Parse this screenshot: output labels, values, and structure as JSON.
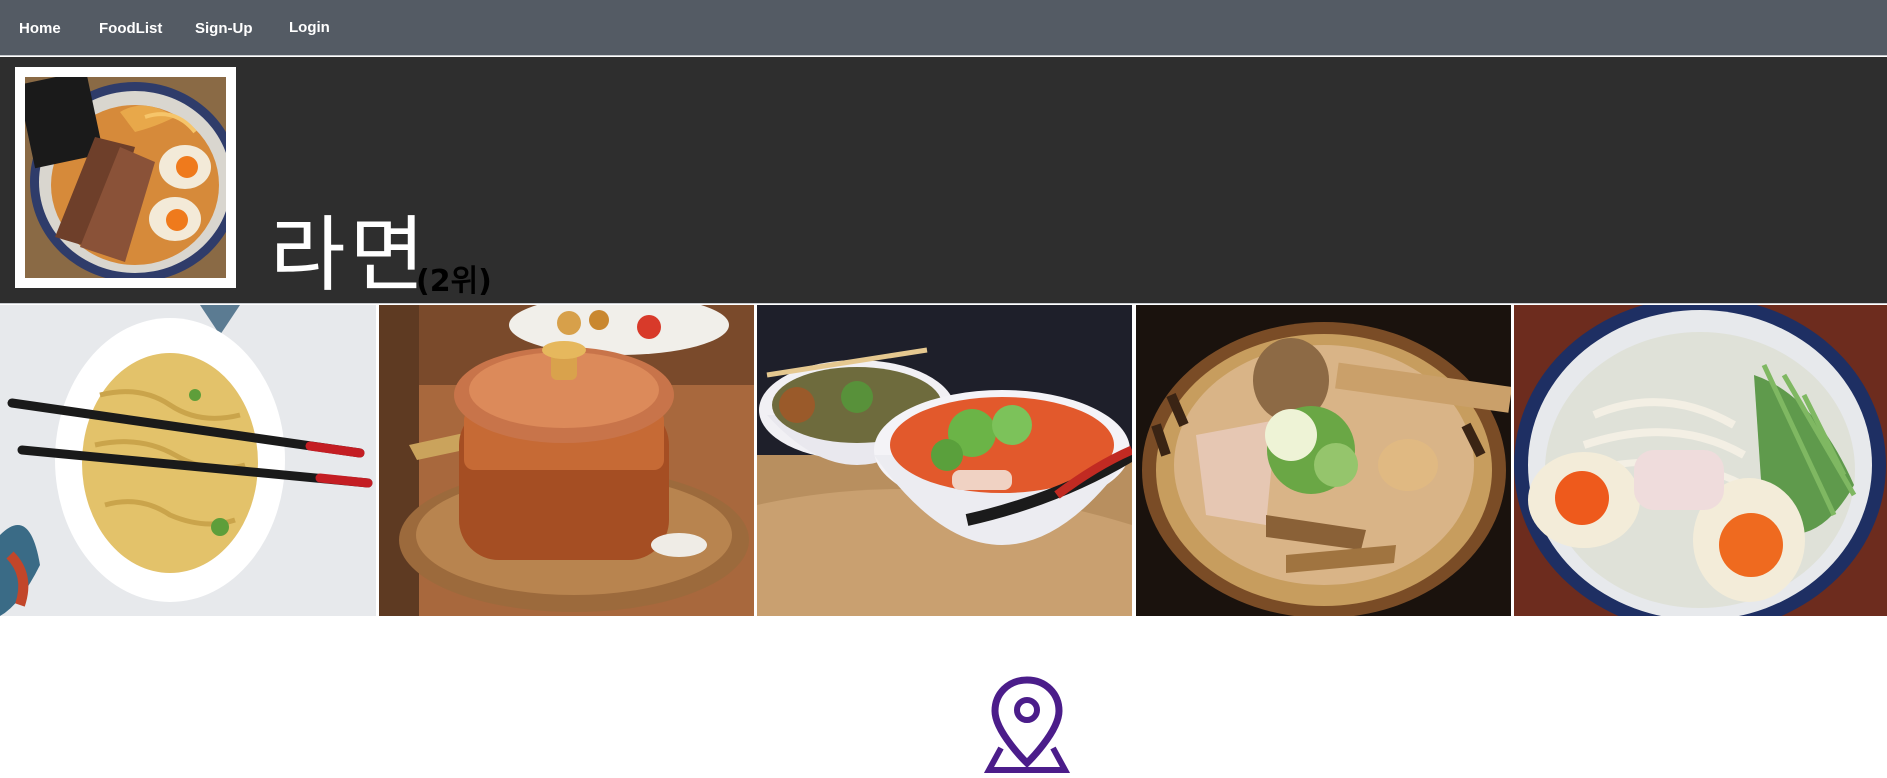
{
  "nav": {
    "items": [
      {
        "label": "Home"
      },
      {
        "label": "FoodList"
      },
      {
        "label": "Sign-Up"
      },
      {
        "label": "Login"
      }
    ]
  },
  "header": {
    "title": "라면",
    "rank": "(2위)",
    "thumbnail_icon": "ramen-bowl-photo"
  },
  "gallery": {
    "photos": [
      {
        "subject": "noodles-with-chopsticks-photo"
      },
      {
        "subject": "copper-pot-photo"
      },
      {
        "subject": "spicy-ramen-bowls-photo"
      },
      {
        "subject": "miso-ramen-bowl-photo"
      },
      {
        "subject": "shio-ramen-with-eggs-photo"
      }
    ]
  },
  "location": {
    "icon": "map-pin-icon",
    "color": "#4b1d8a"
  },
  "colors": {
    "nav_bg": "#545b64",
    "header_bg": "#2e2e2e"
  }
}
